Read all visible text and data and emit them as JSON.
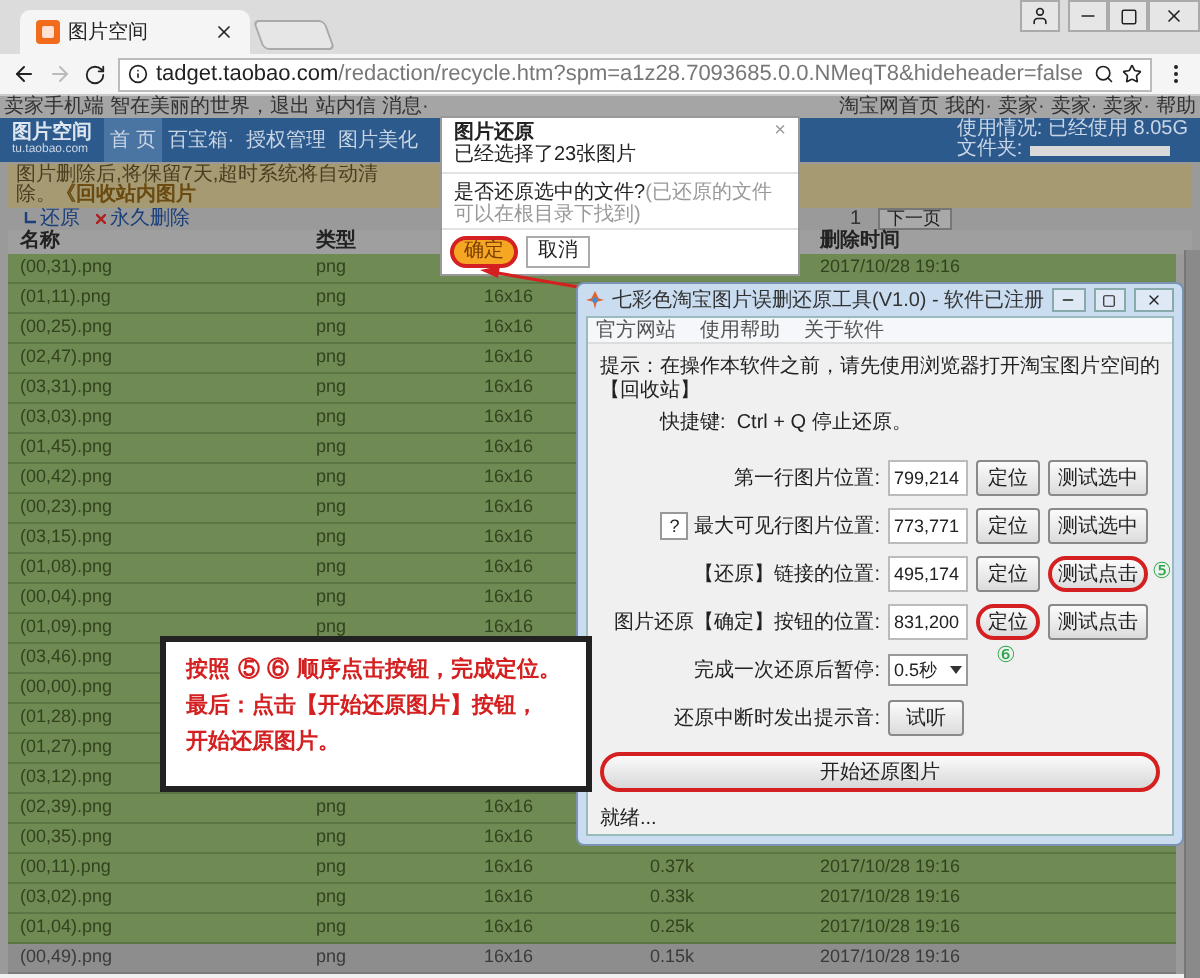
{
  "browser": {
    "tab": {
      "title": "图片空间",
      "selected": true
    },
    "url_host": "tadget.taobao.com",
    "url_path": "/redaction/recycle.htm?spm=a1z28.7093685.0.0.NMeqT8&hideheader=false"
  },
  "site_top": {
    "left": [
      "卖家手机端",
      "智在美丽的世界，退出",
      "站内信",
      "消息·"
    ],
    "right": [
      "淘宝网首页",
      "我的·",
      "卖家·",
      "卖家·",
      "卖家·",
      "帮助"
    ]
  },
  "nav": {
    "logo": "图片空间",
    "logo_sub": "tu.taobao.com",
    "items": [
      {
        "label": "首 页",
        "selected": true
      },
      {
        "label": "百宝箱·",
        "selected": false
      },
      {
        "label": "授权管理",
        "selected": false
      },
      {
        "label": "图片美化",
        "selected": false
      }
    ],
    "usage": "使用情况: 已经使用 8.05G",
    "folder_label": "文件夹:"
  },
  "notice": {
    "text": "图片删除后,将保留7天,超时系统将自动清除。",
    "link": "《回收站内图片"
  },
  "toolbar": {
    "restore": "还原",
    "delete": "永久删除",
    "page": "1",
    "next": "下一页"
  },
  "table": {
    "columns": {
      "name": "名称",
      "type": "类型",
      "date": "删除时间"
    },
    "rows": [
      {
        "name": "(00,31).png",
        "type": "png",
        "date": "2017/10/28 19:16",
        "selected": true
      },
      {
        "name": "(01,11).png",
        "type": "png",
        "dims": "16x16",
        "selected": true
      },
      {
        "name": "(00,25).png",
        "type": "png",
        "dims": "16x16",
        "selected": true
      },
      {
        "name": "(02,47).png",
        "type": "png",
        "dims": "16x16",
        "selected": true
      },
      {
        "name": "(03,31).png",
        "type": "png",
        "dims": "16x16",
        "selected": true
      },
      {
        "name": "(03,03).png",
        "type": "png",
        "dims": "16x16",
        "selected": true
      },
      {
        "name": "(01,45).png",
        "type": "png",
        "dims": "16x16",
        "selected": true
      },
      {
        "name": "(00,42).png",
        "type": "png",
        "dims": "16x16",
        "selected": true
      },
      {
        "name": "(00,23).png",
        "type": "png",
        "dims": "16x16",
        "selected": true
      },
      {
        "name": "(03,15).png",
        "type": "png",
        "dims": "16x16",
        "selected": true
      },
      {
        "name": "(01,08).png",
        "type": "png",
        "dims": "16x16",
        "selected": true
      },
      {
        "name": "(00,04).png",
        "type": "png",
        "dims": "16x16",
        "selected": true
      },
      {
        "name": "(01,09).png",
        "type": "png",
        "dims": "16x16",
        "selected": true
      },
      {
        "name": "(03,46).png",
        "selected": true
      },
      {
        "name": "(00,00).png",
        "selected": true
      },
      {
        "name": "(01,28).png",
        "selected": true
      },
      {
        "name": "(01,27).png",
        "selected": true
      },
      {
        "name": "(03,12).png",
        "selected": true
      },
      {
        "name": "(02,39).png",
        "type": "png",
        "dims": "16x16",
        "selected": true
      },
      {
        "name": "(00,35).png",
        "type": "png",
        "dims": "16x16",
        "selected": true
      },
      {
        "name": "(00,11).png",
        "type": "png",
        "dims": "16x16",
        "size": "0.37k",
        "date": "2017/10/28 19:16",
        "selected": true
      },
      {
        "name": "(03,02).png",
        "type": "png",
        "dims": "16x16",
        "size": "0.33k",
        "date": "2017/10/28 19:16",
        "selected": true
      },
      {
        "name": "(01,04).png",
        "type": "png",
        "dims": "16x16",
        "size": "0.25k",
        "date": "2017/10/28 19:16",
        "selected": true
      },
      {
        "name": "(00,49).png",
        "type": "png",
        "dims": "16x16",
        "size": "0.15k",
        "date": "2017/10/28 19:16",
        "selected": false
      }
    ]
  },
  "confirm_dialog": {
    "title": "图片还原",
    "subtitle": "已经选择了23张图片",
    "close": "×",
    "question": "是否还原选中的文件?",
    "hint": "(已还原的文件可以在根目录下找到)",
    "buttons": [
      {
        "label": "确定",
        "primary": true,
        "highlighted": true
      },
      {
        "label": "取消",
        "primary": false,
        "highlighted": false
      }
    ]
  },
  "tool_window": {
    "title": "七彩色淘宝图片误删还原工具(V1.0) - 软件已注册",
    "menu": [
      "官方网站",
      "使用帮助",
      "关于软件"
    ],
    "hint": "提示：在操作本软件之前，请先使用浏览器打开淘宝图片空间的【回收站】",
    "shortcut": "快捷键:  Ctrl + Q 停止还原。",
    "rows": [
      {
        "kind": "position",
        "label": "第一行图片位置:",
        "value": "799,214",
        "buttons": [
          {
            "label": "定位",
            "highlighted": false
          },
          {
            "label": "测试选中",
            "highlighted": false
          }
        ]
      },
      {
        "kind": "position",
        "help": "?",
        "label": "最大可见行图片位置:",
        "value": "773,771",
        "buttons": [
          {
            "label": "定位",
            "highlighted": false
          },
          {
            "label": "测试选中",
            "highlighted": false
          }
        ]
      },
      {
        "kind": "position",
        "label": "【还原】链接的位置:",
        "value": "495,174",
        "buttons": [
          {
            "label": "定位",
            "highlighted": false
          },
          {
            "label": "测试点击",
            "highlighted": true,
            "marker": "⑤"
          }
        ]
      },
      {
        "kind": "position",
        "label": "图片还原【确定】按钮的位置:",
        "value": "831,200",
        "buttons": [
          {
            "label": "定位",
            "highlighted": true,
            "marker": "⑥"
          },
          {
            "label": "测试点击",
            "highlighted": false
          }
        ]
      },
      {
        "kind": "select",
        "label": "完成一次还原后暂停:",
        "value": "0.5秒"
      },
      {
        "kind": "button",
        "label": "还原中断时发出提示音:",
        "button": "试听"
      }
    ],
    "start": {
      "label": "开始还原图片",
      "highlighted": true
    },
    "status": "就绪..."
  },
  "note": {
    "lines": [
      "按照 ⑤ ⑥ 顺序点击按钮，完成定位。",
      "最后：点击【开始还原图片】按钮，",
      "开始还原图片。"
    ]
  }
}
